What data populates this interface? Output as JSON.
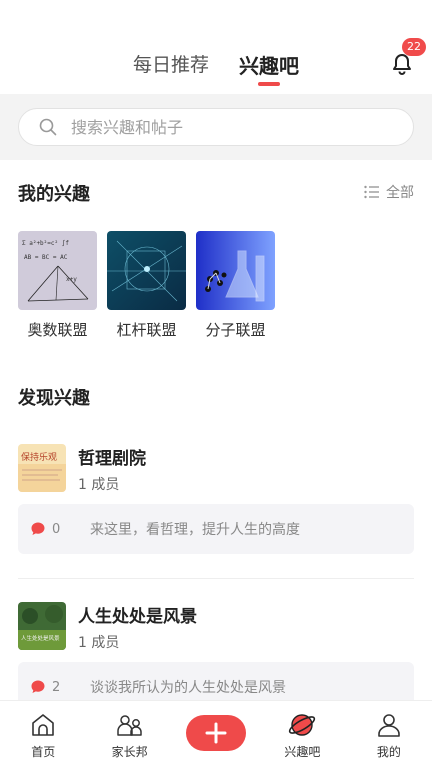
{
  "header": {
    "tabs": [
      {
        "label": "每日推荐",
        "active": false
      },
      {
        "label": "兴趣吧",
        "active": true
      }
    ],
    "notification_count": "22",
    "accent_color": "#ef4a4a"
  },
  "search": {
    "placeholder": "搜索兴趣和帖子"
  },
  "my_interests": {
    "title": "我的兴趣",
    "all_label": "全部",
    "items": [
      {
        "name": "奥数联盟",
        "image": "math-formulas"
      },
      {
        "name": "杠杆联盟",
        "image": "blue-geometry"
      },
      {
        "name": "分子联盟",
        "image": "lab-glassware"
      }
    ]
  },
  "discover": {
    "title": "发现兴趣",
    "groups": [
      {
        "title": "哲理剧院",
        "members": "1 成员",
        "post_count": "0",
        "post_text": "来这里，看哲理，提升人生的高度",
        "avatar_text": "保持乐观"
      },
      {
        "title": "人生处处是风景",
        "members": "1 成员",
        "post_count": "2",
        "post_text": "谈谈我所认为的人生处处是风景",
        "avatar_text": "人生处处是风景"
      }
    ]
  },
  "bottom_nav": [
    {
      "label": "首页",
      "icon": "home-icon"
    },
    {
      "label": "家长邦",
      "icon": "parents-icon"
    },
    {
      "label": "",
      "icon": "add-icon"
    },
    {
      "label": "兴趣吧",
      "icon": "planet-icon",
      "active": true
    },
    {
      "label": "我的",
      "icon": "profile-icon"
    }
  ]
}
